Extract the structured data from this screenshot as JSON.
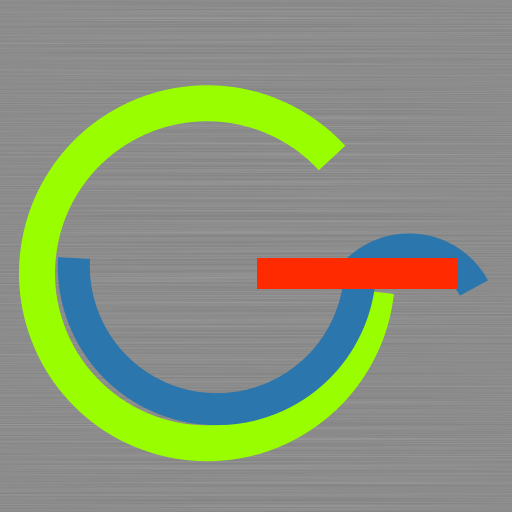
{
  "colors": {
    "background": "#7d7d7d",
    "background_light": "#8c8c8c",
    "background_dark": "#6e6e6e",
    "green_arc": "#99ff00",
    "blue_arc": "#2a76ad",
    "red_bar": "#ff2a00"
  },
  "icon": {
    "semantic": "brushed-metal-logo-icon"
  }
}
